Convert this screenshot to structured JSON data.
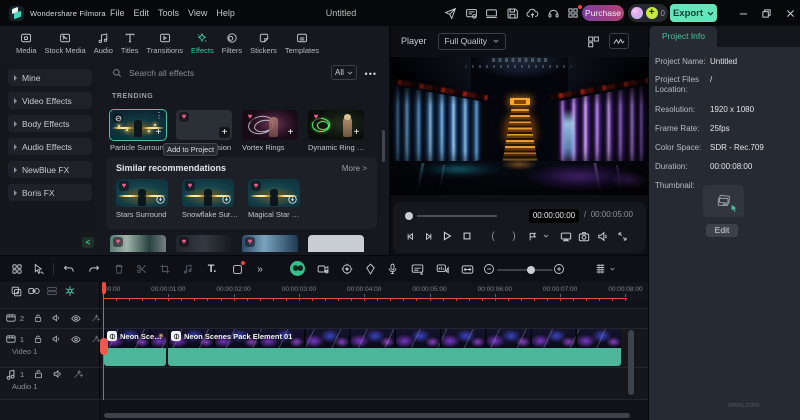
{
  "titlebar": {
    "app_name": "Wondershare Filmora",
    "menus": [
      "File",
      "Edit",
      "Tools",
      "View",
      "Help"
    ],
    "document_title": "Untitled",
    "purchase_label": "Purchase",
    "credits_count": "0",
    "export_label": "Export"
  },
  "media_tabs": [
    {
      "label": "Media"
    },
    {
      "label": "Stock Media"
    },
    {
      "label": "Audio"
    },
    {
      "label": "Titles"
    },
    {
      "label": "Transitions"
    },
    {
      "label": "Effects"
    },
    {
      "label": "Filters"
    },
    {
      "label": "Stickers"
    },
    {
      "label": "Templates"
    }
  ],
  "sidebar": {
    "items": [
      "Mine",
      "Video Effects",
      "Body Effects",
      "Audio Effects",
      "NewBlue FX",
      "Boris FX"
    ]
  },
  "effects_panel": {
    "search_placeholder": "Search all effects",
    "filter_all": "All",
    "more_dots": "•••",
    "section_trending": "TRENDING",
    "tooltip": "Add to Project",
    "trending_cards": [
      {
        "label": "Particle Surround"
      },
      {
        "label": "Neon Expansion"
      },
      {
        "label": "Vortex Rings"
      },
      {
        "label": "Dynamic Ring Universe"
      }
    ],
    "similar": {
      "title": "Similar recommendations",
      "more": "More >",
      "cards": [
        "Stars Surround",
        "Snowflake Surround",
        "Magical Star Surround"
      ]
    }
  },
  "player": {
    "label": "Player",
    "quality": "Full Quality",
    "current_time": "00:00:00:00",
    "separator": "/",
    "total_time": "00:00:05:00"
  },
  "project_info": {
    "tab": "Project Info",
    "rows": [
      {
        "label": "Project Name:",
        "value": "Untitled"
      },
      {
        "label": "Project Files Location:",
        "value": "/"
      },
      {
        "label": "Resolution:",
        "value": "1920 x 1080"
      },
      {
        "label": "Frame Rate:",
        "value": "25fps"
      },
      {
        "label": "Color Space:",
        "value": "SDR - Rec.709"
      },
      {
        "label": "Duration:",
        "value": "00:00:08:00"
      }
    ],
    "thumbnail_label": "Thumbnail:",
    "edit_label": "Edit"
  },
  "toolbar": {
    "text_tool": "T.",
    "more": "»"
  },
  "timeline": {
    "ruler_labels": [
      "00:00",
      "00:00:01:00",
      "00:00:02:00",
      "00:00:03:00",
      "00:00:04:00",
      "00:00:05:00",
      "00:00:06:00",
      "00:00:07:00",
      "00:00:08:00"
    ],
    "tracks": [
      {
        "num": "2",
        "label": ""
      },
      {
        "num": "1",
        "label": "Video 1"
      },
      {
        "num": "1",
        "label": "Audio 1"
      }
    ],
    "clips": [
      {
        "label": "Neon Scenes"
      },
      {
        "label": "Neon Scenes Pack Element 01"
      }
    ]
  },
  "watermark": "wtwu.com",
  "colors": {
    "accent_teal": "#3fc79e",
    "export_green": "#67e5ba",
    "purchase_gradient": "#8a4ad2-#c2447e",
    "playhead_red": "#f04a3c",
    "audio_teal": "#4db59a",
    "badge_pink": "#f05a8e"
  }
}
